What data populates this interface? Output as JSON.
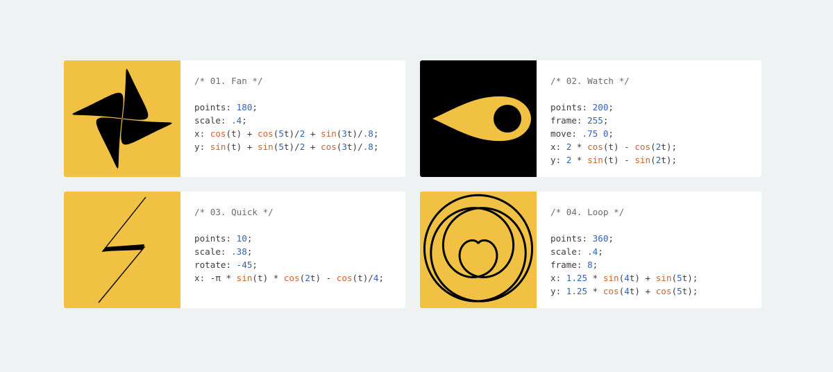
{
  "colors": {
    "yellow": "#f0c143",
    "black": "#000000",
    "number": "#2f63b5",
    "function": "#cc6428"
  },
  "cards": [
    {
      "comment": "/* 01. Fan */",
      "bg": "#f0c143",
      "lines": [
        [
          [
            "points: ",
            ""
          ],
          [
            "180",
            "n"
          ],
          [
            ";",
            ""
          ]
        ],
        [
          [
            "scale: ",
            ""
          ],
          [
            ".4",
            "n"
          ],
          [
            ";",
            ""
          ]
        ],
        [
          [
            "x: ",
            ""
          ],
          [
            "cos",
            "f"
          ],
          [
            "(t) + ",
            ""
          ],
          [
            "cos",
            "f"
          ],
          [
            "(",
            ""
          ],
          [
            "5",
            "n"
          ],
          [
            "t)/",
            ""
          ],
          [
            "2",
            "n"
          ],
          [
            " + ",
            ""
          ],
          [
            "sin",
            "f"
          ],
          [
            "(",
            ""
          ],
          [
            "3",
            "n"
          ],
          [
            "t)/",
            ""
          ],
          [
            ".8",
            "n"
          ],
          [
            ";",
            ""
          ]
        ],
        [
          [
            "y: ",
            ""
          ],
          [
            "sin",
            "f"
          ],
          [
            "(t) + ",
            ""
          ],
          [
            "sin",
            "f"
          ],
          [
            "(",
            ""
          ],
          [
            "5",
            "n"
          ],
          [
            "t)/",
            ""
          ],
          [
            "2",
            "n"
          ],
          [
            " + ",
            ""
          ],
          [
            "cos",
            "f"
          ],
          [
            "(",
            ""
          ],
          [
            "3",
            "n"
          ],
          [
            "t)/",
            ""
          ],
          [
            ".8",
            "n"
          ],
          [
            ";",
            ""
          ]
        ]
      ]
    },
    {
      "comment": "/* 02. Watch */",
      "bg": "#000000",
      "lines": [
        [
          [
            "points: ",
            ""
          ],
          [
            "200",
            "n"
          ],
          [
            ";",
            ""
          ]
        ],
        [
          [
            "frame: ",
            ""
          ],
          [
            "255",
            "n"
          ],
          [
            ";",
            ""
          ]
        ],
        [
          [
            "move: ",
            ""
          ],
          [
            ".75 0",
            "n"
          ],
          [
            ";",
            ""
          ]
        ],
        [
          [
            "x: ",
            ""
          ],
          [
            "2",
            "n"
          ],
          [
            " * ",
            ""
          ],
          [
            "cos",
            "f"
          ],
          [
            "(t) - ",
            ""
          ],
          [
            "cos",
            "f"
          ],
          [
            "(",
            ""
          ],
          [
            "2",
            "n"
          ],
          [
            "t);",
            ""
          ]
        ],
        [
          [
            "y: ",
            ""
          ],
          [
            "2",
            "n"
          ],
          [
            " * ",
            ""
          ],
          [
            "sin",
            "f"
          ],
          [
            "(t) - ",
            ""
          ],
          [
            "sin",
            "f"
          ],
          [
            "(",
            ""
          ],
          [
            "2",
            "n"
          ],
          [
            "t);",
            ""
          ]
        ]
      ]
    },
    {
      "comment": "/* 03. Quick */",
      "bg": "#f0c143",
      "lines": [
        [
          [
            "points: ",
            ""
          ],
          [
            "10",
            "n"
          ],
          [
            ";",
            ""
          ]
        ],
        [
          [
            "scale: ",
            ""
          ],
          [
            ".38",
            "n"
          ],
          [
            ";",
            ""
          ]
        ],
        [
          [
            "rotate: ",
            ""
          ],
          [
            "-45",
            "n"
          ],
          [
            ";",
            ""
          ]
        ],
        [
          [
            "x: -π * ",
            ""
          ],
          [
            "sin",
            "f"
          ],
          [
            "(t) * ",
            ""
          ],
          [
            "cos",
            "f"
          ],
          [
            "(",
            ""
          ],
          [
            "2",
            "n"
          ],
          [
            "t) - ",
            ""
          ],
          [
            "cos",
            "f"
          ],
          [
            "(t)/",
            ""
          ],
          [
            "4",
            "n"
          ],
          [
            ";",
            ""
          ]
        ]
      ]
    },
    {
      "comment": "/* 04. Loop */",
      "bg": "#f0c143",
      "lines": [
        [
          [
            "points: ",
            ""
          ],
          [
            "360",
            "n"
          ],
          [
            ";",
            ""
          ]
        ],
        [
          [
            "scale: ",
            ""
          ],
          [
            ".4",
            "n"
          ],
          [
            ";",
            ""
          ]
        ],
        [
          [
            "frame: ",
            ""
          ],
          [
            "8",
            "n"
          ],
          [
            ";",
            ""
          ]
        ],
        [
          [
            "x: ",
            ""
          ],
          [
            "1.25",
            "n"
          ],
          [
            " * ",
            ""
          ],
          [
            "sin",
            "f"
          ],
          [
            "(",
            ""
          ],
          [
            "4",
            "n"
          ],
          [
            "t) + ",
            ""
          ],
          [
            "sin",
            "f"
          ],
          [
            "(",
            ""
          ],
          [
            "5",
            "n"
          ],
          [
            "t);",
            ""
          ]
        ],
        [
          [
            "y: ",
            ""
          ],
          [
            "1.25",
            "n"
          ],
          [
            " * ",
            ""
          ],
          [
            "cos",
            "f"
          ],
          [
            "(",
            ""
          ],
          [
            "4",
            "n"
          ],
          [
            "t) + ",
            ""
          ],
          [
            "cos",
            "f"
          ],
          [
            "(",
            ""
          ],
          [
            "5",
            "n"
          ],
          [
            "t);",
            ""
          ]
        ]
      ]
    }
  ]
}
